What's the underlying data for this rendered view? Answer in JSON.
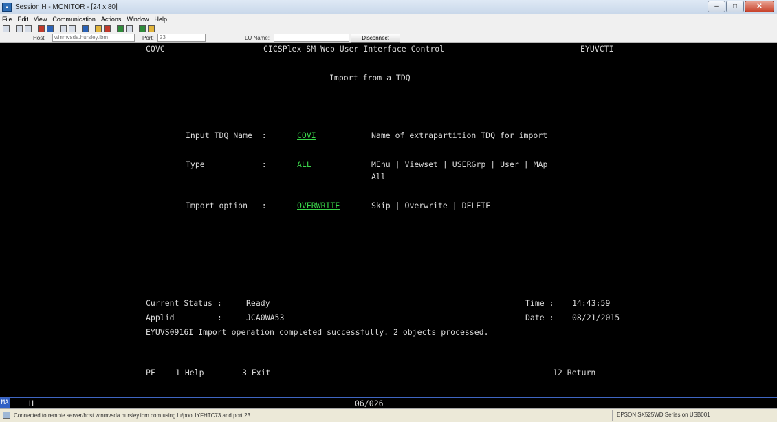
{
  "window": {
    "title": "Session H - MONITOR - [24 x 80]",
    "icon_label": "3270",
    "buttons": [
      "minimize-icon",
      "maximize-icon",
      "close-icon"
    ]
  },
  "menu": [
    "File",
    "Edit",
    "View",
    "Communication",
    "Actions",
    "Window",
    "Help"
  ],
  "connection": {
    "host_label": "Host:",
    "host_value": "winmvsda.hursley.ibm",
    "port_label": "Port:",
    "port_value": "23",
    "lu_label": "LU Name:",
    "lu_value": "",
    "disconnect_label": "Disconnect"
  },
  "screen": {
    "transaction": "COVC",
    "heading": "CICSPlex SM Web User Interface Control",
    "screen_id": "EYUVCTI",
    "subtitle": "Import from a TDQ",
    "fields": [
      {
        "label": "Input TDQ Name  :",
        "value": "COVI",
        "help": "Name of extrapartition TDQ for import"
      },
      {
        "label": "Type            :",
        "value": "ALL",
        "options": [
          "MEnu",
          "Viewset",
          "USERGrp",
          "User",
          "MAp"
        ],
        "options2": "All"
      },
      {
        "label": "Import option   :",
        "value": "OVERWRITE",
        "options": [
          "Skip",
          "Overwrite",
          "DELETE"
        ]
      }
    ],
    "status_label": "Current Status :",
    "status_value": "Ready",
    "time_label": "Time :",
    "time_value": "14:43:59",
    "applid_label": "Applid         :",
    "applid_value": "JCA0WA53",
    "date_label": "Date :",
    "date_value": "08/21/2015",
    "message": "EYUVS0916I Import operation completed successfully. 2 objects processed.",
    "pf_prefix": "PF",
    "pf_keys": [
      {
        "key": "1",
        "label": "Help"
      },
      {
        "key": "3",
        "label": "Exit"
      },
      {
        "key": "12",
        "label": "Return"
      }
    ]
  },
  "oia": {
    "ma": "MA",
    "session": "H",
    "cursor": "06/026"
  },
  "statusbar": {
    "message": "Connected to remote server/host winmvsda.hursley.ibm.com using lu/pool IYFHTC73 and port 23",
    "printer": "EPSON SX525WD Series on USB001"
  }
}
